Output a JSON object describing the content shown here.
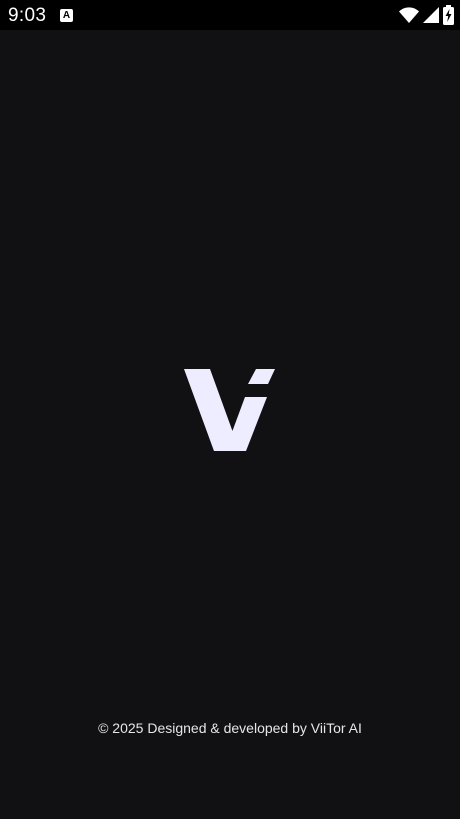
{
  "status_bar": {
    "time": "9:03",
    "notification_badge": "A",
    "icons": [
      "wifi-icon",
      "signal-icon",
      "battery-charging-icon"
    ]
  },
  "splash": {
    "logo_name": "viitor-logo",
    "logo_color": "#EEECFF",
    "background_color": "#111113"
  },
  "footer": {
    "text": "© 2025 Designed & developed by ViiTor AI"
  }
}
